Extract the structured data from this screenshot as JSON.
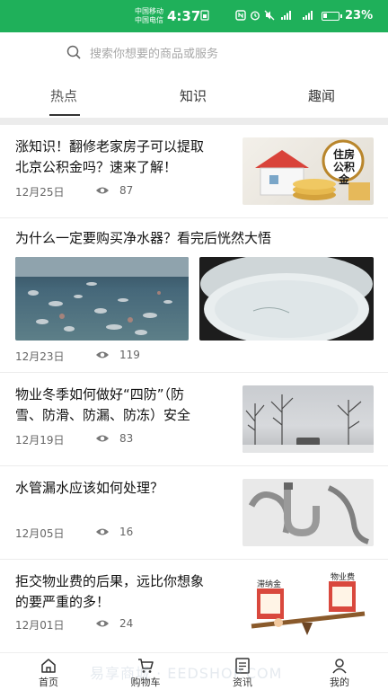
{
  "status_bar": {
    "carrier_1": "中国移动",
    "carrier_2": "中国电信",
    "time": "4:37",
    "battery": "23%",
    "battery_level": 0.23
  },
  "search": {
    "placeholder": "搜索你想要的商品或服务"
  },
  "tabs": [
    {
      "label": "热点",
      "active": true
    },
    {
      "label": "知识",
      "active": false
    },
    {
      "label": "趣闻",
      "active": false
    }
  ],
  "articles": [
    {
      "title_line1": "涨知识！翻修老家房子可以提取",
      "title_line2": "北京公积金吗？速来了解！",
      "date": "12月25日",
      "views": "87",
      "thumb_text": "住房公积金"
    },
    {
      "title_line1": "为什么一定要购买净水器？看完后恍然大悟",
      "date": "12月23日",
      "views": "119"
    },
    {
      "title_line1": "物业冬季如何做好“四防”（防",
      "title_line2": "雪、防滑、防漏、防冻）安全",
      "date": "12月19日",
      "views": "83"
    },
    {
      "title_line1": "水管漏水应该如何处理？",
      "date": "12月05日",
      "views": "16"
    },
    {
      "title_line1": "拒交物业费的后果，远比你想象",
      "title_line2": "的要严重的多！",
      "date": "12月01日",
      "views": "24",
      "thumb_text_1": "滞纳金",
      "thumb_text_2": "物业费"
    }
  ],
  "bottom_nav": [
    {
      "label": "首页",
      "icon": "home-icon"
    },
    {
      "label": "购物车",
      "icon": "cart-icon"
    },
    {
      "label": "资讯",
      "icon": "news-icon"
    },
    {
      "label": "我的",
      "icon": "user-icon"
    }
  ],
  "watermark": "易享商城 · EEDSHOP.COM",
  "colors": {
    "status_bar": "#1fb05a",
    "text": "#111111",
    "meta": "#666666"
  }
}
